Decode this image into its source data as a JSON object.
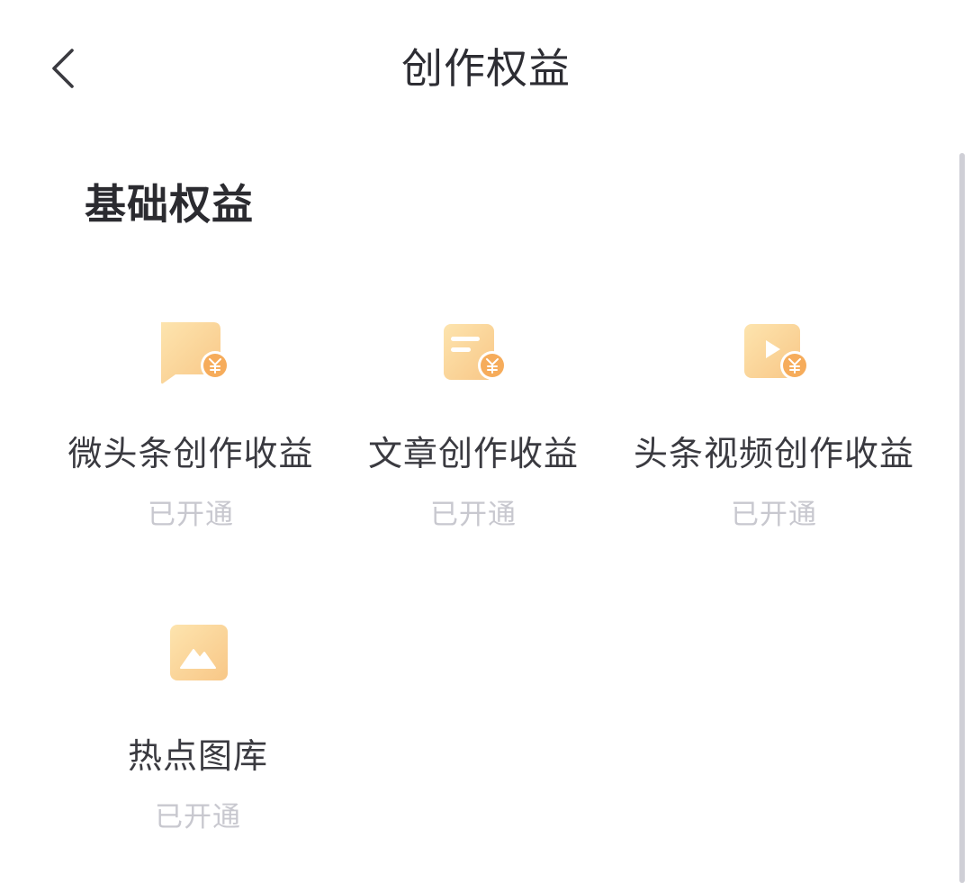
{
  "header": {
    "title": "创作权益",
    "back_icon": "chevron-left-icon"
  },
  "section": {
    "title": "基础权益"
  },
  "benefits": [
    {
      "label": "微头条创作收益",
      "status": "已开通",
      "icon": "chat-bubble-yuan-icon"
    },
    {
      "label": "文章创作收益",
      "status": "已开通",
      "icon": "document-yuan-icon"
    },
    {
      "label": "头条视频创作收益",
      "status": "已开通",
      "icon": "video-play-yuan-icon"
    },
    {
      "label": "热点图库",
      "status": "已开通",
      "icon": "image-mountain-icon"
    }
  ],
  "colors": {
    "icon_gradient_start": "#fde1a8",
    "icon_gradient_end": "#f8c98a",
    "icon_badge": "#f6ac5b",
    "status_text": "#c8c8cf",
    "title_text": "#2d2d33"
  }
}
